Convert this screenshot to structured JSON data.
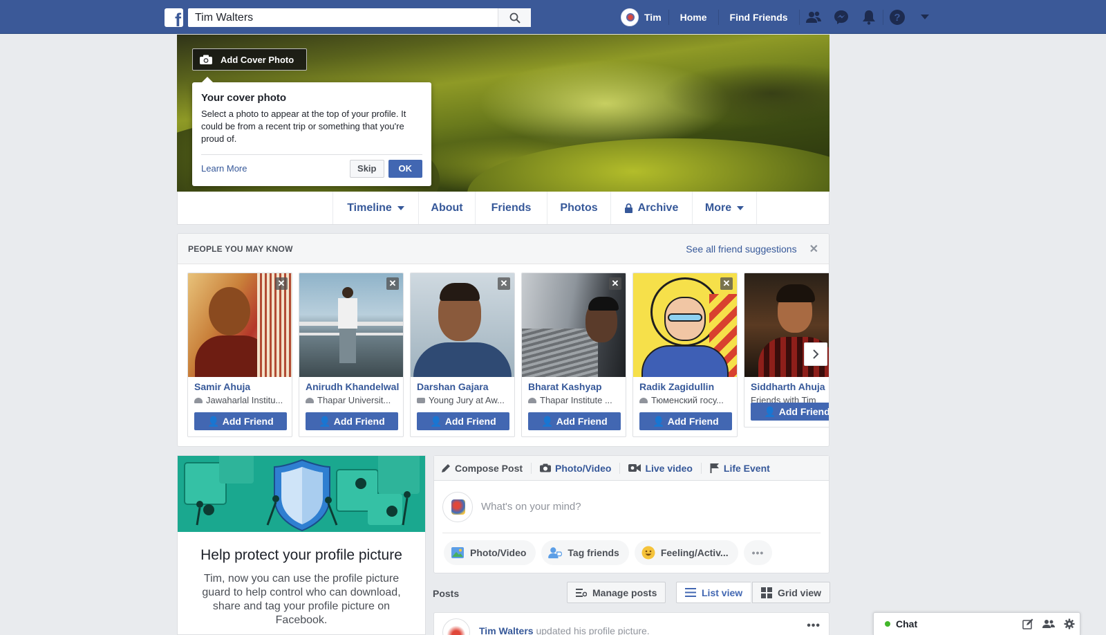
{
  "topbar": {
    "logo": "f",
    "search_value": "Tim Walters",
    "user_name": "Tim",
    "links": [
      "Home",
      "Find Friends"
    ],
    "icons": [
      "friends-icon",
      "messenger-icon",
      "notifications-icon",
      "help-icon",
      "account-menu-icon"
    ]
  },
  "cover": {
    "add_cover_label": "Add Cover Photo",
    "popup": {
      "title": "Your cover photo",
      "body": "Select a photo to appear at the top of your profile. It could be from a recent trip or something that you're proud of.",
      "learn_more": "Learn More",
      "skip": "Skip",
      "ok": "OK"
    }
  },
  "tabs": [
    "Timeline",
    "About",
    "Friends",
    "Photos",
    "Archive",
    "More"
  ],
  "pymk": {
    "title": "PEOPLE YOU MAY KNOW",
    "see_all": "See all friend suggestions",
    "add_friend_label": "Add Friend",
    "people": [
      {
        "name": "Samir Ahuja",
        "sub": "Jawaharlal Institu..."
      },
      {
        "name": "Anirudh Khandelwal",
        "sub": "Thapar Universit..."
      },
      {
        "name": "Darshan Gajara",
        "sub": "Young Jury at Aw..."
      },
      {
        "name": "Bharat Kashyap",
        "sub": "Thapar Institute ..."
      },
      {
        "name": "Radik Zagidullin",
        "sub": "Тюменский госу..."
      },
      {
        "name": "Siddharth Ahuja",
        "sub": "Friends with Tim"
      }
    ]
  },
  "guard": {
    "title": "Help protect your profile picture",
    "body": "Tim, now you can use the profile picture guard to help control who can download, share and tag your profile picture on Facebook."
  },
  "composer": {
    "tabs": [
      "Compose Post",
      "Photo/Video",
      "Live video",
      "Life Event"
    ],
    "placeholder": "What's on your mind?",
    "actions": [
      "Photo/Video",
      "Tag friends",
      "Feeling/Activ..."
    ],
    "more": "•••"
  },
  "posts": {
    "label": "Posts",
    "manage": "Manage posts",
    "list_view": "List view",
    "grid_view": "Grid view",
    "first_post_name": "Tim Walters",
    "first_post_text": " updated his profile picture."
  },
  "chat": {
    "label": "Chat"
  },
  "colors": {
    "brand": "#3b5998",
    "button": "#4267b2",
    "link": "#365899",
    "online": "#42b72a"
  }
}
